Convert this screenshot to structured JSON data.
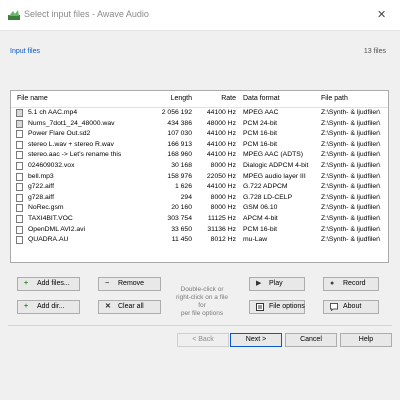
{
  "window": {
    "title": "Select input files - Awave Audio",
    "close_icon": "close-icon"
  },
  "list_header": {
    "label": "Input files",
    "count": "13 files"
  },
  "columns": {
    "name": "File name",
    "length": "Length",
    "rate": "Rate",
    "format": "Data format",
    "path": "File path"
  },
  "files": [
    {
      "icon": "multi-file-icon",
      "name": "5.1 ch AAC.mp4",
      "length": "2 056 192",
      "rate": "44100 Hz",
      "format": "MPEG AAC",
      "path": "Z:\\Synth- & ljudfiler\\"
    },
    {
      "icon": "multi-file-icon",
      "name": "Nums_7dot1_24_48000.wav",
      "length": "434 386",
      "rate": "48000 Hz",
      "format": "PCM 24-bit",
      "path": "Z:\\Synth- & ljudfiler\\"
    },
    {
      "icon": "file-icon",
      "name": "Power Flare Out.sd2",
      "length": "107 030",
      "rate": "44100 Hz",
      "format": "PCM 16-bit",
      "path": "Z:\\Synth- & ljudfiler\\"
    },
    {
      "icon": "file-icon",
      "name": "stereo L.wav + stereo R.wav",
      "length": "166 913",
      "rate": "44100 Hz",
      "format": "PCM 16-bit",
      "path": "Z:\\Synth- & ljudfiler\\"
    },
    {
      "icon": "file-icon",
      "name": "stereo.aac -> Let's rename this",
      "length": "168 960",
      "rate": "44100 Hz",
      "format": "MPEG AAC (ADTS)",
      "path": "Z:\\Synth- & ljudfiler\\"
    },
    {
      "icon": "file-icon",
      "name": "024609032.vox",
      "length": "30 168",
      "rate": "8000 Hz",
      "format": "Dialogic ADPCM 4-bit",
      "path": "Z:\\Synth- & ljudfiler\\"
    },
    {
      "icon": "file-icon",
      "name": "bell.mp3",
      "length": "158 976",
      "rate": "22050 Hz",
      "format": "MPEG audio layer III",
      "path": "Z:\\Synth- & ljudfiler\\"
    },
    {
      "icon": "file-icon",
      "name": "g722.aiff",
      "length": "1 626",
      "rate": "44100 Hz",
      "format": "G.722 ADPCM",
      "path": "Z:\\Synth- & ljudfiler\\"
    },
    {
      "icon": "file-icon",
      "name": "g728.aiff",
      "length": "294",
      "rate": "8000 Hz",
      "format": "G.728 LD-CELP",
      "path": "Z:\\Synth- & ljudfiler\\"
    },
    {
      "icon": "file-icon",
      "name": "NoRec.gsm",
      "length": "20 160",
      "rate": "8000 Hz",
      "format": "GSM 06.10",
      "path": "Z:\\Synth- & ljudfiler\\"
    },
    {
      "icon": "file-icon",
      "name": "TAXI4BIT.VOC",
      "length": "303 754",
      "rate": "11125 Hz",
      "format": "APCM 4-bit",
      "path": "Z:\\Synth- & ljudfiler\\"
    },
    {
      "icon": "file-icon",
      "name": "OpenDML AVI2.avi",
      "length": "33 650",
      "rate": "31136 Hz",
      "format": "PCM 16-bit",
      "path": "Z:\\Synth- & ljudfiler\\"
    },
    {
      "icon": "file-icon",
      "name": "QUADRA.AU",
      "length": "11 450",
      "rate": "8012 Hz",
      "format": "mu-Law",
      "path": "Z:\\Synth- & ljudfiler\\"
    }
  ],
  "buttons": {
    "add_files": "Add files...",
    "remove": "Remove",
    "add_dir": "Add dir...",
    "clear_all": "Clear all",
    "play": "Play",
    "record": "Record",
    "file_options": "File options",
    "about": "About",
    "back": "< Back",
    "next": "Next >",
    "cancel": "Cancel",
    "help": "Help"
  },
  "hint": {
    "line1": "Double-click or",
    "line2": "right-click on a file for",
    "line3": "per file options"
  },
  "colors": {
    "accent": "#0a58c9",
    "add_icon": "#2e8b2e",
    "remove_icon": "#444444",
    "clear_icon": "#222222",
    "play_icon": "#333333",
    "record_icon": "#444444",
    "about_icon": "#555555"
  }
}
